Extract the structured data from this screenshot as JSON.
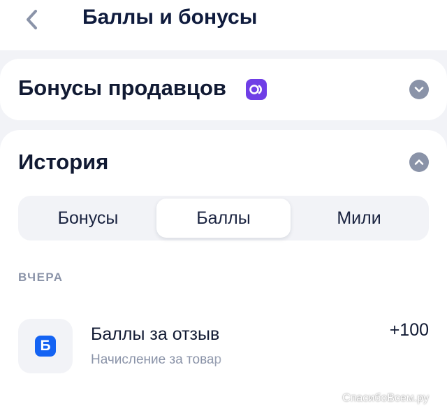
{
  "header": {
    "title": "Баллы и бонусы",
    "back_icon": "chevron-left-icon"
  },
  "sellers": {
    "title": "Бонусы продавцов",
    "badge_icon": "brand-badge-icon",
    "expanded": false
  },
  "history": {
    "title": "История",
    "expanded": true,
    "tabs": [
      {
        "label": "Бонусы",
        "selected": false
      },
      {
        "label": "Баллы",
        "selected": true
      },
      {
        "label": "Мили",
        "selected": false
      }
    ],
    "section_label": "ВЧЕРА",
    "transactions": [
      {
        "icon_letter": "Б",
        "title": "Баллы за отзыв",
        "subtitle": "Начисление за товар",
        "amount": "+100"
      }
    ]
  },
  "watermark": "СпасибоВсем.ру",
  "colors": {
    "accent_blue": "#1463f3",
    "brand_purple": "#6f3ee6",
    "muted": "#8a93a8"
  }
}
